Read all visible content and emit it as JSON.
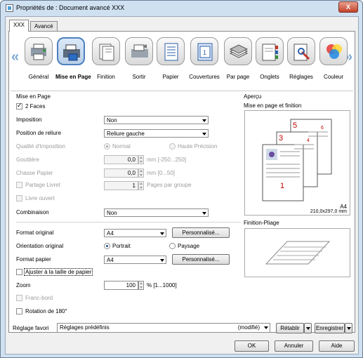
{
  "window": {
    "title": "Propriétés de : Document avancé XXX",
    "close_label": "X"
  },
  "tabs": [
    {
      "label": "XXX"
    },
    {
      "label": "Avancé"
    }
  ],
  "categories": [
    {
      "label": "Général",
      "icon": "general-icon"
    },
    {
      "label": "Mise en Page",
      "icon": "layout-icon"
    },
    {
      "label": "Finition",
      "icon": "finishing-icon"
    },
    {
      "label": "Sortir",
      "icon": "output-icon"
    },
    {
      "label": "Papier",
      "icon": "paper-icon"
    },
    {
      "label": "Couvertures",
      "icon": "covers-icon"
    },
    {
      "label": "Par page",
      "icon": "per-page-icon"
    },
    {
      "label": "Onglets",
      "icon": "tabs-icon"
    },
    {
      "label": "Réglages",
      "icon": "settings-icon"
    },
    {
      "label": "Couleur",
      "icon": "color-icon"
    }
  ],
  "layout": {
    "section_title": "Mise en Page",
    "two_sided_label": "2 Faces",
    "imposition_label": "Imposition",
    "imposition_value": "Non",
    "binding_label": "Position de reliure",
    "binding_value": "Reliure gauche",
    "quality_label": "Qualité d'Imposition",
    "quality_normal": "Normal",
    "quality_high": "Haute Précision",
    "gutter_label": "Gouttière",
    "gutter_value": "0,0",
    "gutter_unit": "mm [-250...250]",
    "creep_label": "Chasse Papier",
    "creep_value": "0,0",
    "creep_unit": "mm [0...50]",
    "split_booklet_label": "Partage Livret",
    "split_booklet_value": "1",
    "split_booklet_unit": "Pages par groupe",
    "open_book_label": "Livre ouvert",
    "combination_label": "Combinaison",
    "combination_value": "Non",
    "original_size_label": "Format original",
    "original_size_value": "A4",
    "custom1_label": "Personnalisé...",
    "orientation_label": "Orientation original",
    "portrait_label": "Portrait",
    "landscape_label": "Paysage",
    "paper_size_label": "Format papier",
    "paper_size_value": "A4",
    "custom2_label": "Personnalisé...",
    "fit_label": "Ajuster à la taille de papier",
    "zoom_label": "Zoom",
    "zoom_value": "100",
    "zoom_unit": "% [1...1000]",
    "full_bleed_label": "Franc-bord",
    "rotate_label": "Rotation de 180°"
  },
  "preview": {
    "section_title": "Aperçu",
    "layout_title": "Mise en page et finition",
    "paper_size": "A4",
    "paper_dims": "210,0x297,0 mm",
    "fold_title": "Finition-Pliage"
  },
  "favorites": {
    "label": "Réglage favori",
    "value": "Réglages prédéfinis",
    "modified": "(modifié)",
    "restore_label": "Rétablir",
    "save_label": "Enregistrer"
  },
  "footer": {
    "ok": "OK",
    "cancel": "Annuler",
    "help": "Aide"
  },
  "colors": {
    "accent": "#4e7fbf",
    "page_numbers": "#c00000"
  }
}
